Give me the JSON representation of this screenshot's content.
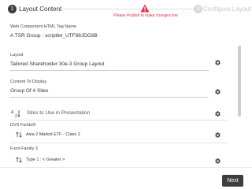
{
  "stepper": {
    "step1": {
      "number": "1",
      "label": "Layout Content"
    },
    "warning": "Please Publish to make changes live",
    "step3": {
      "number": "3",
      "label": "Configure Layout"
    }
  },
  "fields": {
    "tag_name": {
      "label": "Web Component HTML Tag Name",
      "value": "A TSR Group : scriptlet_UTF98JDG9B"
    },
    "layout": {
      "label": "Layout",
      "value": "Tailored Shareholder 30e-3 Group Layout"
    },
    "content": {
      "label": "Content To Display",
      "value": "Group Of 4 Sites"
    }
  },
  "sites": {
    "title": "Sites to Use in Presentation",
    "groups": [
      {
        "label": "DVS Funds9!",
        "item": "Asia 2 Market ETF - Class 2"
      },
      {
        "label": "Fund Family 3",
        "item": "Type 1 : < Greater >"
      }
    ]
  },
  "footer": {
    "next_label": "Next"
  },
  "colors": {
    "warning": "#e0304a",
    "primary_dark": "#3e3e3e",
    "muted": "#c6c6c6"
  },
  "icons": [
    "gear-icon",
    "sort-arrows-icon",
    "sort-az-icon",
    "warning-icon"
  ]
}
